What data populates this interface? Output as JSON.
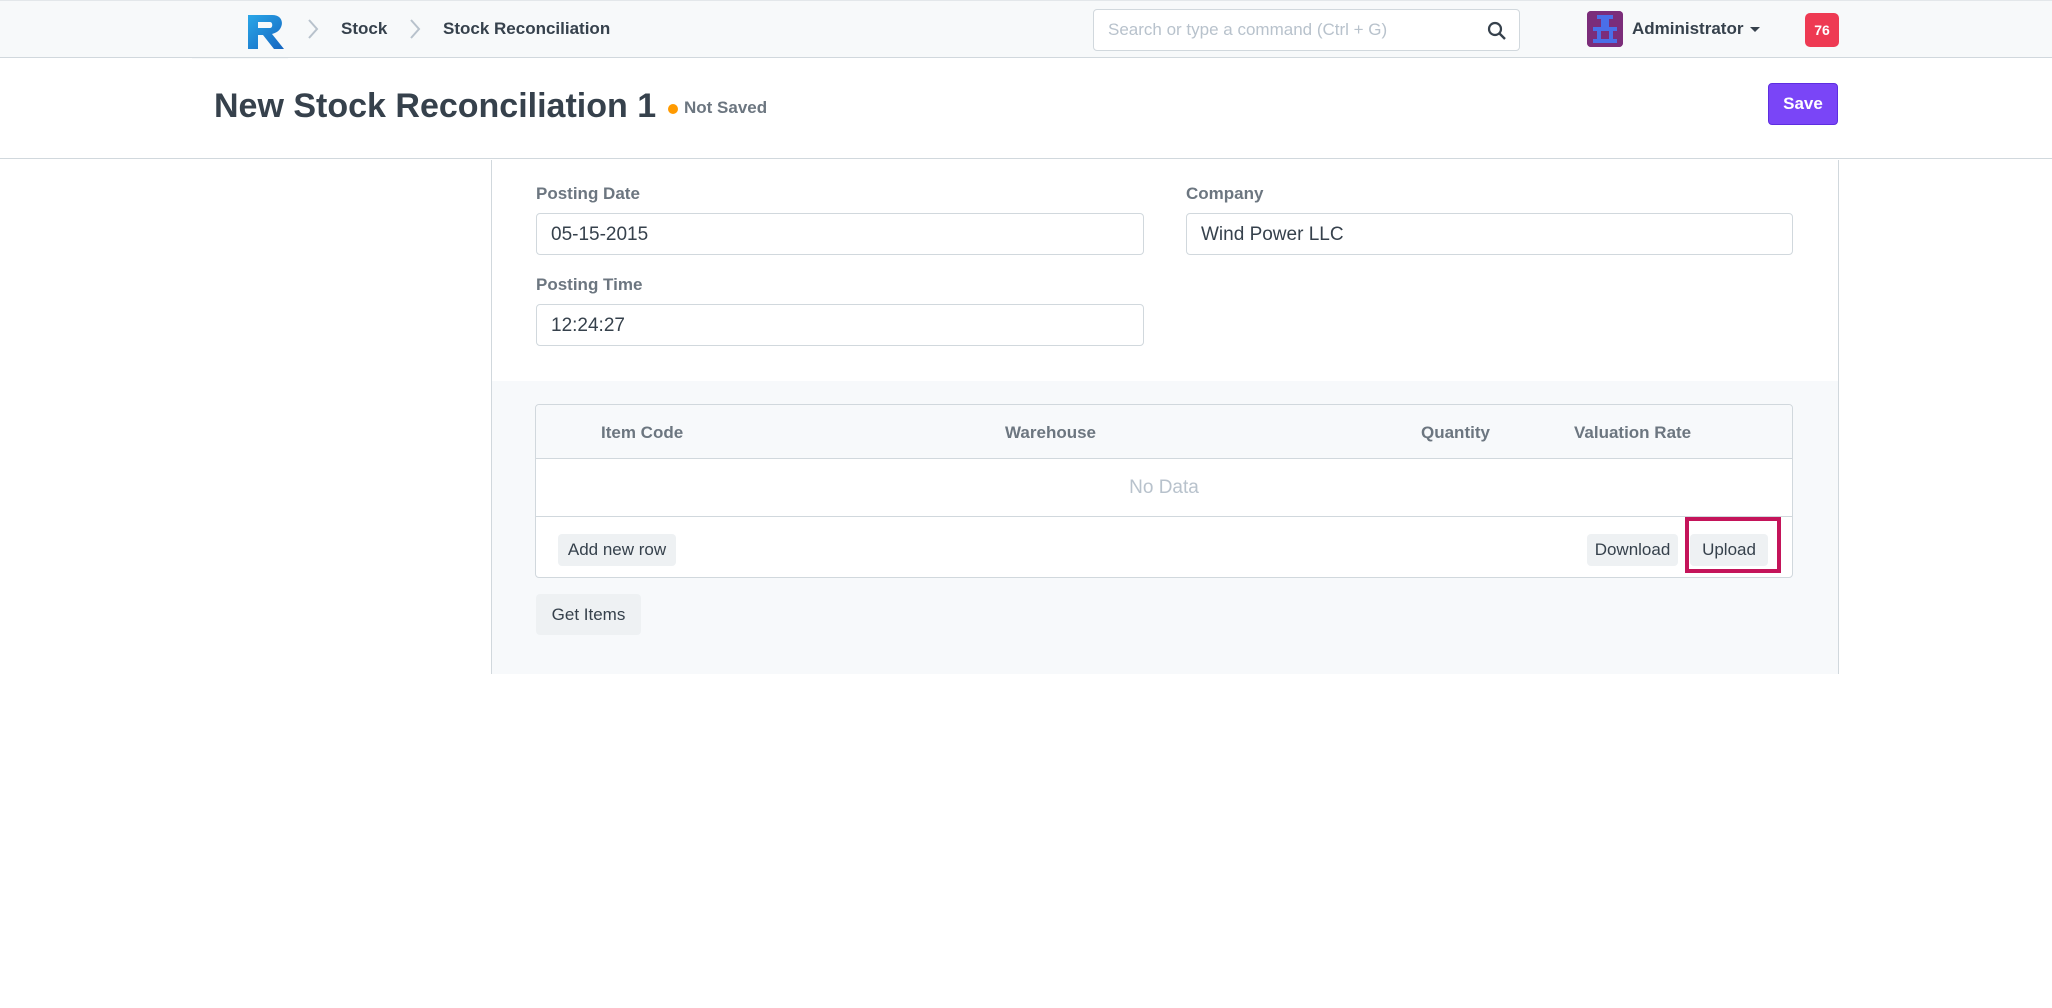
{
  "navbar": {
    "breadcrumbs": [
      {
        "label": "Stock"
      },
      {
        "label": "Stock Reconciliation"
      }
    ],
    "search": {
      "placeholder": "Search or type a command (Ctrl + G)",
      "value": ""
    },
    "user": {
      "name": "Administrator"
    },
    "notifications": {
      "count": "76"
    }
  },
  "page": {
    "title": "New Stock Reconciliation 1",
    "status": "Not Saved",
    "save_label": "Save"
  },
  "form": {
    "posting_date": {
      "label": "Posting Date",
      "value": "05-15-2015"
    },
    "company": {
      "label": "Company",
      "value": "Wind Power LLC"
    },
    "posting_time": {
      "label": "Posting Time",
      "value": "12:24:27"
    }
  },
  "items_table": {
    "columns": [
      "Item Code",
      "Warehouse",
      "Quantity",
      "Valuation Rate"
    ],
    "empty_text": "No Data",
    "add_row_label": "Add new row",
    "download_label": "Download",
    "upload_label": "Upload"
  },
  "get_items_label": "Get Items",
  "colors": {
    "primary": "#7a45f7",
    "notification": "#ee3a53",
    "status_dot": "#ff9a00",
    "highlight": "#c4145a"
  },
  "icons": {
    "logo": "app-logo-icon",
    "breadcrumb_separator": "chevron-right-icon",
    "search": "search-icon",
    "avatar": "avatar-icon",
    "dropdown": "caret-down-icon"
  }
}
